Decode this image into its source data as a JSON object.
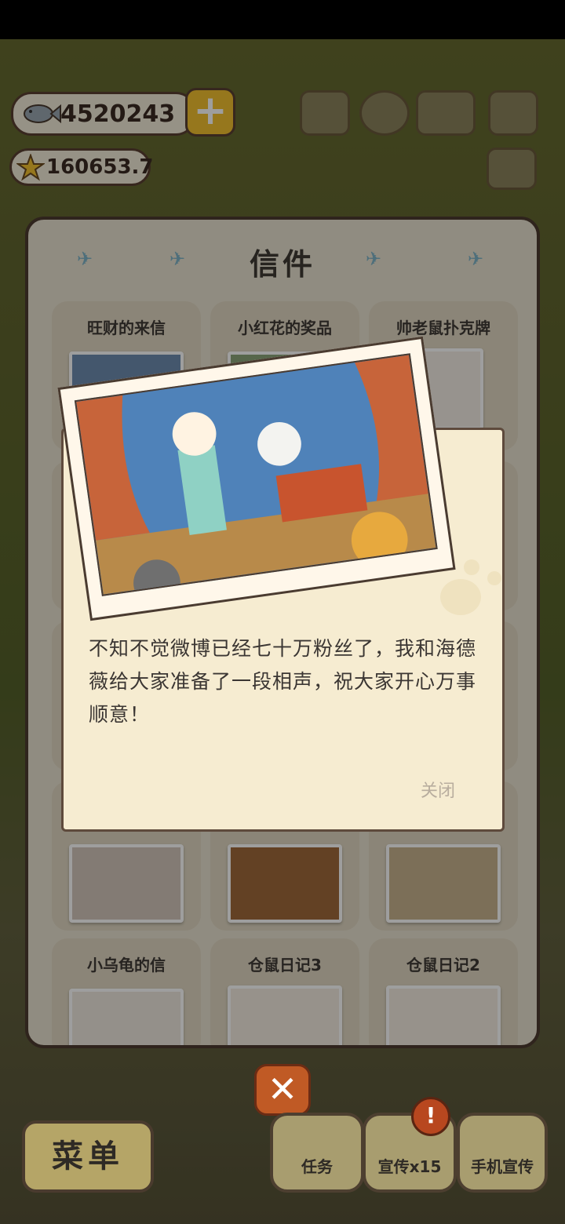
{
  "currency": {
    "fish": "4520243",
    "stars": "160653.7",
    "plus_label": "+"
  },
  "panel": {
    "title": "信件",
    "letters": [
      {
        "title": "旺财的来信"
      },
      {
        "title": "小红花的奖品"
      },
      {
        "title": "帅老鼠扑克牌"
      },
      {
        "title": ""
      },
      {
        "title": ""
      },
      {
        "title": ""
      },
      {
        "title": "小乌龟的信"
      },
      {
        "title": "仓鼠日记3"
      },
      {
        "title": "仓鼠日记2"
      }
    ]
  },
  "dialog": {
    "message": "不知不觉微博已经七十万粉丝了，我和海德薇给大家准备了一段相声，祝大家开心万事顺意！",
    "close_label": "关闭"
  },
  "bottom": {
    "menu_label": "菜单",
    "close_x": "✕",
    "task_label": "任务",
    "promote_label": "宣传x15",
    "phone_promote_label": "手机宣传",
    "badge": "!"
  },
  "colors": {
    "panel_bg": "#e9e2d0",
    "letter_bg": "#f6ecd1",
    "accent_orange": "#c05a25",
    "gold": "#f2c12f"
  }
}
